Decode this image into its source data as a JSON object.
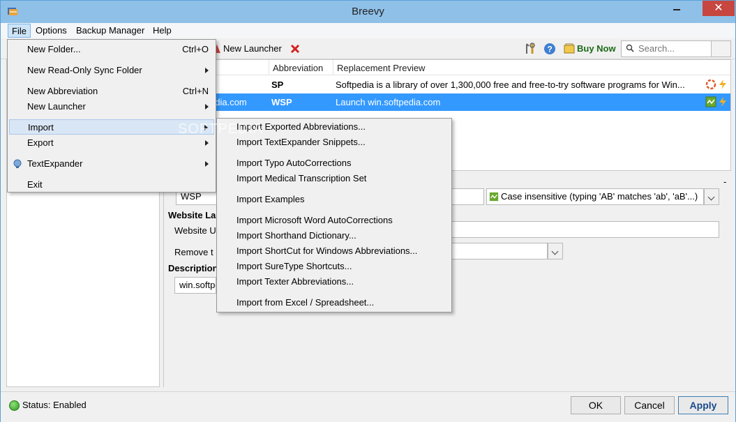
{
  "window": {
    "title": "Breevy"
  },
  "menubar": {
    "file": "File",
    "options": "Options",
    "backup_manager": "Backup Manager",
    "help": "Help"
  },
  "toolbar": {
    "new_launcher": "New Launcher",
    "buy_now": "Buy Now",
    "search_placeholder": "Search..."
  },
  "grid": {
    "headers": {
      "abbreviation": "Abbreviation",
      "replacement_preview": "Replacement Preview"
    },
    "rows": [
      {
        "name": "",
        "abbreviation": "SP",
        "preview": "Softpedia is a library of over 1,300,000 free and free-to-try software programs for Win..."
      },
      {
        "name": "edia.com",
        "abbreviation": "WSP",
        "preview": "Launch win.softpedia.com"
      }
    ]
  },
  "details": {
    "abbreviation_value": "WSP",
    "case_option": "Case insensitive (typing 'AB' matches 'ab', 'aB'...)",
    "website_label_partial": "Website La",
    "website_url_label_partial": "Website U",
    "remove_label_partial": "Remove t",
    "description_label_partial": "Description",
    "description_value_partial": "win.softpe",
    "collapse_marker": "-"
  },
  "status": {
    "text": "Status: Enabled"
  },
  "buttons": {
    "ok": "OK",
    "cancel": "Cancel",
    "apply": "Apply"
  },
  "file_menu": {
    "items": [
      {
        "label": "New Folder...",
        "shortcut": "Ctrl+O"
      },
      {
        "label": "New Read-Only Sync Folder"
      },
      {
        "label": "New Abbreviation",
        "shortcut": "Ctrl+N"
      },
      {
        "label": "New Launcher"
      },
      {
        "label": "Import"
      },
      {
        "label": "Export"
      },
      {
        "label": "TextExpander"
      },
      {
        "label": "Exit"
      }
    ]
  },
  "import_menu": {
    "items": [
      "Import Exported Abbreviations...",
      "Import TextExpander Snippets...",
      "Import Typo AutoCorrections",
      "Import Medical Transcription Set",
      "Import Examples",
      "Import Microsoft Word AutoCorrections",
      "Import Shorthand Dictionary...",
      "Import ShortCut for Windows Abbreviations...",
      "Import SureType Shortcuts...",
      "Import Texter Abbreviations...",
      "Import from Excel / Spreadsheet..."
    ]
  },
  "watermark": "SOFTPEDIA",
  "colors": {
    "selection": "#3399ff",
    "titlebar": "#8fc0e8",
    "close": "#c7463f",
    "buy_now": "#1b6b17"
  }
}
